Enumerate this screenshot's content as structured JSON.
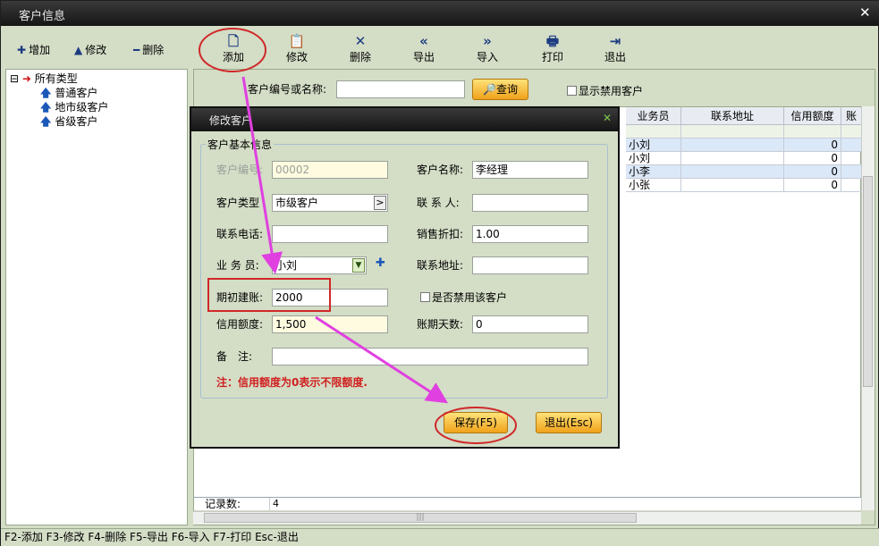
{
  "window": {
    "title": "客户信息",
    "close_glyph": "✕"
  },
  "header_actions": [
    {
      "icon": "plus-icon",
      "glyph": "✚",
      "label": "增加"
    },
    {
      "icon": "triangle-up-icon",
      "glyph": "▲",
      "label": "修改"
    },
    {
      "icon": "minus-icon",
      "glyph": "━",
      "label": "删除"
    }
  ],
  "toolbar": [
    {
      "icon": "document-icon",
      "glyph": "🗋",
      "label": "添加"
    },
    {
      "icon": "edit-doc-icon",
      "glyph": "📋",
      "label": "修改"
    },
    {
      "icon": "delete-x-icon",
      "glyph": "✕",
      "label": "删除"
    },
    {
      "icon": "double-left-icon",
      "glyph": "«",
      "label": "导出"
    },
    {
      "icon": "double-right-icon",
      "glyph": "»",
      "label": "导入"
    },
    {
      "icon": "printer-icon",
      "glyph": "🖶",
      "label": "打印"
    },
    {
      "icon": "exit-door-icon",
      "glyph": "⇥",
      "label": "退出"
    }
  ],
  "tree": {
    "root": "所有类型",
    "expander": "⊟",
    "children": [
      "普通客户",
      "地市级客户",
      "省级客户"
    ]
  },
  "search": {
    "label": "客户编号或名称:",
    "value": "",
    "button": "查询",
    "show_disabled": "显示禁用客户"
  },
  "grid": {
    "columns": [
      "业务员",
      "联系地址",
      "信用额度",
      "账"
    ],
    "rows": [
      {
        "salesman": "小刘",
        "address": "",
        "credit": "0"
      },
      {
        "salesman": "小刘",
        "address": "",
        "credit": "0"
      },
      {
        "salesman": "小李",
        "address": "",
        "credit": "0"
      },
      {
        "salesman": "小张",
        "address": "",
        "credit": "0"
      }
    ],
    "footer_label": "记录数:",
    "footer_value": "4",
    "hscroll_grip": "|||"
  },
  "dialog": {
    "title": "修改客户",
    "close_glyph": "✕",
    "group_title": "客户基本信息",
    "fields": {
      "code_label": "客户编号:",
      "code_value": "00002",
      "name_label": "客户名称:",
      "name_value": "李经理",
      "type_label": "客户类型",
      "type_value": "市级客户",
      "type_button": ">",
      "contact_label": "联 系 人:",
      "contact_value": "",
      "phone_label": "联系电话:",
      "phone_value": "",
      "discount_label": "销售折扣:",
      "discount_value": "1.00",
      "salesman_label": "业 务 员:",
      "salesman_value": "小刘",
      "salesman_add": "✚",
      "address_label": "联系地址:",
      "address_value": "",
      "opening_label": "期初建账:",
      "opening_value": "2000",
      "disabled_label": "是否禁用该客户",
      "credit_label": "信用额度:",
      "credit_value": "1,500",
      "days_label": "账期天数:",
      "days_value": "0",
      "remark_label": "备　注:",
      "remark_value": ""
    },
    "note": "注：信用额度为0表示不限额度.",
    "save_button": "保存(F5)",
    "exit_button": "退出(Esc)"
  },
  "status_bar": "F2-添加 F3-修改 F4-删除 F5-导出 F6-导入 F7-打印 Esc-退出",
  "colors": {
    "annotation": "#e040e0",
    "highlight": "#d02828",
    "note": "#d02020"
  }
}
